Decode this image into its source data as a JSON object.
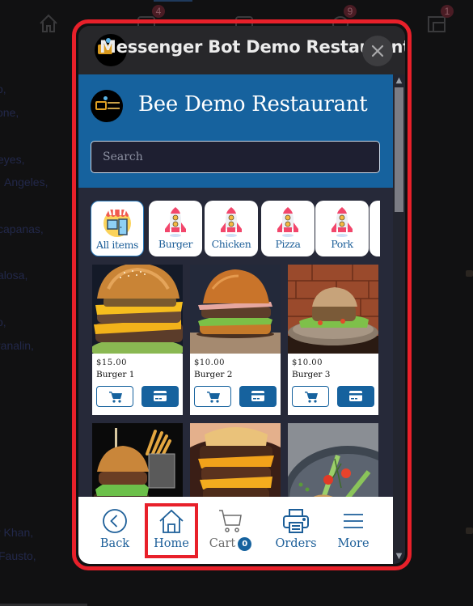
{
  "background": {
    "top_nav_badges": [
      "4",
      "9",
      "1"
    ],
    "list_fragments": [
      "o,",
      "one,",
      "eyes,",
      "Angeles,",
      "capanas,",
      "alosa,",
      "o,",
      "ranalin,",
      "r Khan,",
      "Fausto,"
    ]
  },
  "dialog": {
    "title": "Messenger Bot Demo Restaurant",
    "close_icon": "close-icon"
  },
  "webview": {
    "restaurant_name": "Bee Demo Restaurant",
    "search": {
      "placeholder": "Search",
      "value": ""
    },
    "categories": [
      {
        "label": "All items",
        "icon": "store-icon",
        "active": true
      },
      {
        "label": "Burger",
        "icon": "rocket-icon",
        "active": false
      },
      {
        "label": "Chicken",
        "icon": "rocket-icon",
        "active": false
      },
      {
        "label": "Pizza",
        "icon": "rocket-icon",
        "active": false
      },
      {
        "label": "Pork",
        "icon": "rocket-icon",
        "active": false
      }
    ],
    "products": [
      {
        "price": "$15.00",
        "name": "Burger 1"
      },
      {
        "price": "$10.00",
        "name": "Burger 2"
      },
      {
        "price": "$10.00",
        "name": "Burger 3"
      },
      {
        "price": "",
        "name": ""
      },
      {
        "price": "",
        "name": ""
      },
      {
        "price": "",
        "name": ""
      }
    ],
    "bottom_nav": {
      "back": "Back",
      "home": "Home",
      "cart": "Cart",
      "cart_count": "0",
      "orders": "Orders",
      "more": "More"
    }
  },
  "colors": {
    "brand_blue": "#16629e",
    "highlight_red": "#e8202a",
    "dialog_bg": "#27272a",
    "webview_bg": "#262939"
  }
}
